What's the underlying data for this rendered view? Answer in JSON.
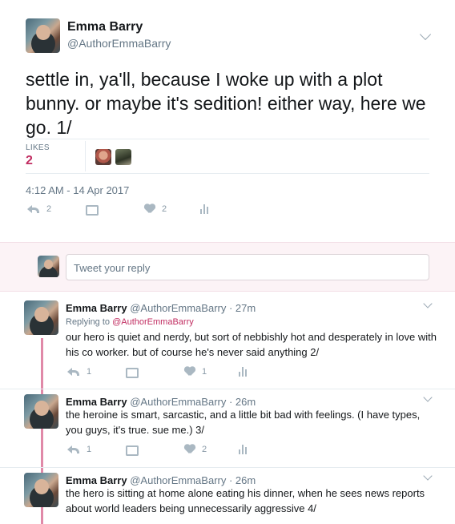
{
  "main_tweet": {
    "name": "Emma Barry",
    "handle": "@AuthorEmmaBarry",
    "text": "settle in, ya'll, because I woke up with a plot bunny. or maybe it's sedition! either way, here we go. 1/",
    "likes_label": "LIKES",
    "likes_count": "2",
    "timestamp": "4:12 AM - 14 Apr 2017",
    "reply_count": "2",
    "like_count": "2"
  },
  "composer": {
    "placeholder": "Tweet your reply"
  },
  "replies": [
    {
      "name": "Emma Barry",
      "meta": "@AuthorEmmaBarry · 27m",
      "replying_prefix": "Replying to ",
      "replying_handle": "@AuthorEmmaBarry",
      "text": "our hero is quiet and nerdy, but sort of nebbishly hot and desperately in love with his co worker. but of course he's never said anything 2/",
      "reply_count": "1",
      "like_count": "1"
    },
    {
      "name": "Emma Barry",
      "meta": "@AuthorEmmaBarry · 26m",
      "text": "the heroine is smart, sarcastic, and a little bit bad with feelings. (I have types, you guys, it's true. sue me.) 3/",
      "reply_count": "1",
      "like_count": "2"
    },
    {
      "name": "Emma Barry",
      "meta": "@AuthorEmmaBarry · 26m",
      "text": "the hero is sitting at home alone eating his dinner, when he sees news reports about world leaders being unnecessarily aggressive 4/"
    }
  ],
  "colors": {
    "accent": "#c12d61",
    "thread_line": "#e089a8",
    "composer_bg": "#fcf3f6"
  }
}
